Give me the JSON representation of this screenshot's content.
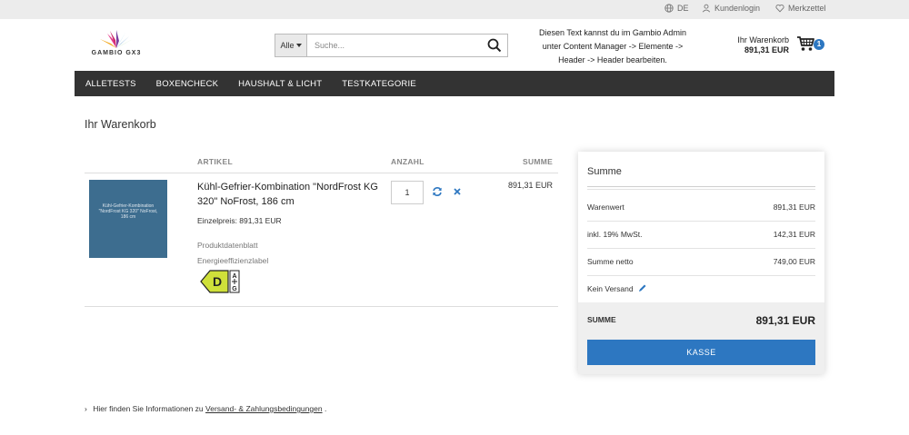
{
  "topbar": {
    "language": "DE",
    "login": "Kundenlogin",
    "wishlist": "Merkzettel"
  },
  "header": {
    "logo_text": "GAMBIO GX3",
    "search": {
      "category": "Alle",
      "placeholder": "Suche..."
    },
    "info_lines": [
      "Diesen Text kannst du im Gambio Admin",
      "unter Content Manager -> Elemente ->",
      "Header -> Header bearbeiten."
    ],
    "cart": {
      "label": "Ihr Warenkorb",
      "total": "891,31 EUR",
      "count": "1"
    }
  },
  "nav": {
    "items": [
      "ALLETESTS",
      "BOXENCHECK",
      "HAUSHALT & LICHT",
      "TESTKATEGORIE"
    ]
  },
  "cart": {
    "title": "Ihr Warenkorb",
    "columns": {
      "article": "ARTIKEL",
      "quantity": "ANZAHL",
      "sum": "SUMME"
    },
    "item": {
      "thumb_text": "Kühl-Gefrier-Kombination \"NordFrost KG 320\" NoFrost, 186 cm",
      "name": "Kühl-Gefrier-Kombination \"NordFrost KG 320\" NoFrost, 186 cm",
      "unit_price": "Einzelpreis: 891,31 EUR",
      "datasheet": "Produktdatenblatt",
      "energy_label_link": "Energieeffizienzlabel",
      "energy_class": "D",
      "energy_scale_top": "A",
      "energy_scale_bottom": "G",
      "quantity": "1",
      "sum": "891,31 EUR"
    }
  },
  "summary": {
    "title": "Summe",
    "rows": [
      {
        "label": "Warenwert",
        "value": "891,31 EUR"
      },
      {
        "label": "inkl. 19% MwSt.",
        "value": "142,31 EUR"
      },
      {
        "label": "Summe netto",
        "value": "749,00 EUR"
      }
    ],
    "shipping": "Kein Versand",
    "total_label": "SUMME",
    "total_value": "891,31 EUR",
    "checkout_label": "KASSE"
  },
  "footer": {
    "chevron": "›",
    "text_before": "Hier finden Sie Informationen zu",
    "link": "Versand- & Zahlungsbedingungen",
    "text_after": "."
  },
  "colors": {
    "accent": "#2d77c1",
    "nav_bg": "#333333",
    "energy_label": "#cfe03a"
  },
  "icons": [
    "globe-icon",
    "user-icon",
    "heart-icon",
    "chevron-down-icon",
    "search-icon",
    "cart-icon",
    "refresh-icon",
    "close-icon",
    "pencil-icon",
    "chevron-right-icon"
  ]
}
